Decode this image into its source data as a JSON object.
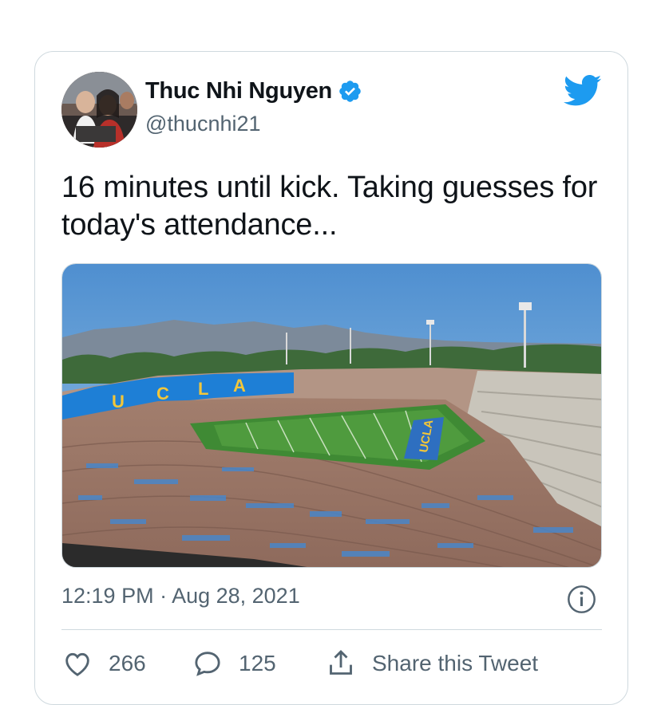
{
  "tweet": {
    "author": {
      "display_name": "Thuc Nhi Nguyen",
      "handle": "@thucnhi21",
      "verified": true
    },
    "text": "16 minutes until kick. Taking guesses for today's attendance...",
    "timestamp": "12:19 PM · Aug 28, 2021",
    "actions": {
      "likes": "266",
      "replies": "125",
      "share_label": "Share this Tweet"
    },
    "media": {
      "stadium_lettering": [
        "U",
        "C",
        "L",
        "A"
      ],
      "endzone_lettering": "UCLA"
    }
  },
  "colors": {
    "accent": "#1d9bf0",
    "text_primary": "#0f1419",
    "text_secondary": "#536471",
    "border": "#cfd9de"
  },
  "icons": {
    "bird": "twitter-bird-icon",
    "verified": "verified-badge-icon",
    "info": "info-icon",
    "like": "heart-icon",
    "reply": "reply-icon",
    "share": "share-icon"
  }
}
